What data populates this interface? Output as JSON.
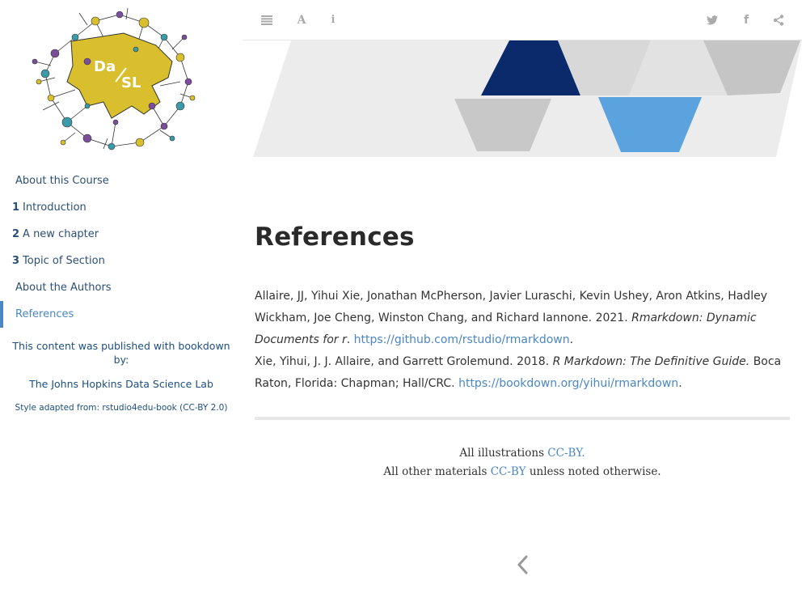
{
  "sidebar": {
    "toc": [
      {
        "num": "",
        "label": "About this Course"
      },
      {
        "num": "1",
        "label": "Introduction"
      },
      {
        "num": "2",
        "label": "A new chapter"
      },
      {
        "num": "3",
        "label": "Topic of Section"
      },
      {
        "num": "",
        "label": "About the Authors"
      },
      {
        "num": "",
        "label": "References"
      }
    ],
    "published_by": "This content was published with bookdown by:",
    "lab": "The Johns Hopkins Data Science Lab",
    "style_note": "Style adapted from: rstudio4edu-book (CC-BY 2.0)"
  },
  "header": {
    "icons": [
      "menu-icon",
      "font-icon",
      "info-icon",
      "twitter-icon",
      "facebook-icon",
      "share-icon"
    ]
  },
  "page": {
    "title": "References"
  },
  "references": [
    {
      "authors": "Allaire, JJ, Yihui Xie, Jonathan McPherson, Javier Luraschi, Kevin Ushey, Aron Atkins, Hadley Wickham, Joe Cheng, Winston Chang, and Richard Iannone. 2021.",
      "title": "Rmarkdown: Dynamic Documents for r",
      "url": "https://github.com/rstudio/rmarkdown"
    },
    {
      "authors": "Xie, Yihui, J. J. Allaire, and Garrett Grolemund. 2018.",
      "title": "R Markdown: The Definitive Guide",
      "rest": "Boca Raton, Florida: Chapman; Hall/CRC.",
      "url": "https://bookdown.org/yihui/rmarkdown"
    }
  ],
  "footer": {
    "line1_text": "All illustrations",
    "line1_link": "CC-BY.",
    "line2_text": "All other materials",
    "line2_link": "CC-BY",
    "line2_tail": "unless noted otherwise."
  },
  "logo": {
    "text_top": "Da",
    "text_bottom": "SL",
    "colors": {
      "yellow": "#d9bf2e",
      "teal": "#3a9aa8",
      "purple": "#7a4e9a",
      "navy": "#1b2e57"
    }
  },
  "banner_colors": {
    "navy": "#0b2a6b",
    "blue": "#5ba3df",
    "gray": "#c8c8c8",
    "light": "#e8e8e8"
  }
}
